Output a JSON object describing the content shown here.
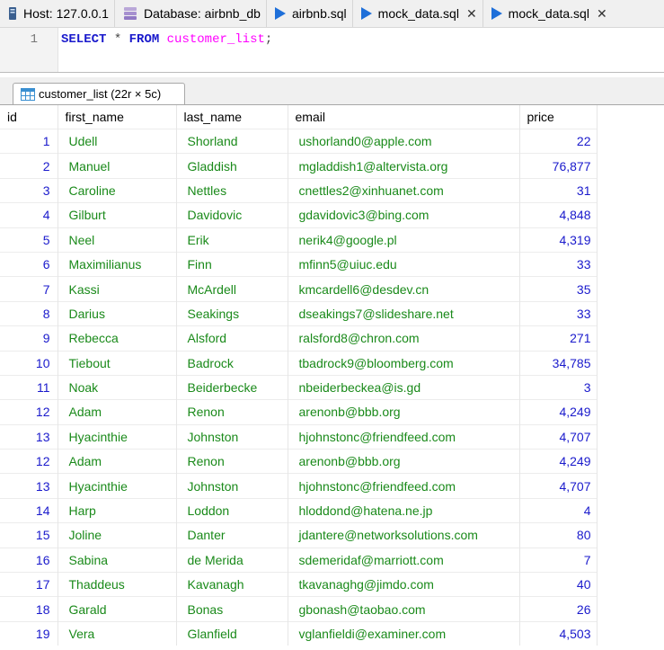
{
  "tabs": [
    {
      "label": "Host: 127.0.0.1",
      "icon": "server-icon",
      "closable": false
    },
    {
      "label": "Database: airbnb_db",
      "icon": "database-icon",
      "closable": false
    },
    {
      "label": "airbnb.sql",
      "icon": "query-play-icon",
      "closable": false
    },
    {
      "label": "mock_data.sql",
      "icon": "query-play-icon",
      "closable": true
    },
    {
      "label": "mock_data.sql",
      "icon": "query-play-icon",
      "closable": true
    }
  ],
  "close_glyph": "✕",
  "editor": {
    "line_number": "1",
    "kw_select": "SELECT",
    "star": "*",
    "kw_from": "FROM",
    "table": "customer_list",
    "semicolon": ";"
  },
  "result_tab": {
    "label": "customer_list (22r × 5c)"
  },
  "colors": {
    "keyword": "#1a1acc",
    "table_name": "#ff00ff",
    "text_value": "#1a8a1a",
    "number_value": "#1a1acc"
  },
  "columns": [
    "id",
    "first_name",
    "last_name",
    "email",
    "price"
  ],
  "rows": [
    [
      "1",
      "Udell",
      "Shorland",
      "ushorland0@apple.com",
      "22"
    ],
    [
      "2",
      "Manuel",
      "Gladdish",
      "mgladdish1@altervista.org",
      "76,877"
    ],
    [
      "3",
      "Caroline",
      "Nettles",
      "cnettles2@xinhuanet.com",
      "31"
    ],
    [
      "4",
      "Gilburt",
      "Davidovic",
      "gdavidovic3@bing.com",
      "4,848"
    ],
    [
      "5",
      "Neel",
      "Erik",
      "nerik4@google.pl",
      "4,319"
    ],
    [
      "6",
      "Maximilianus",
      "Finn",
      "mfinn5@uiuc.edu",
      "33"
    ],
    [
      "7",
      "Kassi",
      "McArdell",
      "kmcardell6@desdev.cn",
      "35"
    ],
    [
      "8",
      "Darius",
      "Seakings",
      "dseakings7@slideshare.net",
      "33"
    ],
    [
      "9",
      "Rebecca",
      "Alsford",
      "ralsford8@chron.com",
      "271"
    ],
    [
      "10",
      "Tiebout",
      "Badrock",
      "tbadrock9@bloomberg.com",
      "34,785"
    ],
    [
      "11",
      "Noak",
      "Beiderbecke",
      "nbeiderbeckea@is.gd",
      "3"
    ],
    [
      "12",
      "Adam",
      "Renon",
      "arenonb@bbb.org",
      "4,249"
    ],
    [
      "13",
      "Hyacinthie",
      "Johnston",
      "hjohnstonc@friendfeed.com",
      "4,707"
    ],
    [
      "12",
      "Adam",
      "Renon",
      "arenonb@bbb.org",
      "4,249"
    ],
    [
      "13",
      "Hyacinthie",
      "Johnston",
      "hjohnstonc@friendfeed.com",
      "4,707"
    ],
    [
      "14",
      "Harp",
      "Loddon",
      "hloddond@hatena.ne.jp",
      "4"
    ],
    [
      "15",
      "Joline",
      "Danter",
      "jdantere@networksolutions.com",
      "80"
    ],
    [
      "16",
      "Sabina",
      "de Merida",
      "sdemeridaf@marriott.com",
      "7"
    ],
    [
      "17",
      "Thaddeus",
      "Kavanagh",
      "tkavanaghg@jimdo.com",
      "40"
    ],
    [
      "18",
      "Garald",
      "Bonas",
      "gbonash@taobao.com",
      "26"
    ],
    [
      "19",
      "Vera",
      "Glanfield",
      "vglanfieldi@examiner.com",
      "4,503"
    ]
  ]
}
